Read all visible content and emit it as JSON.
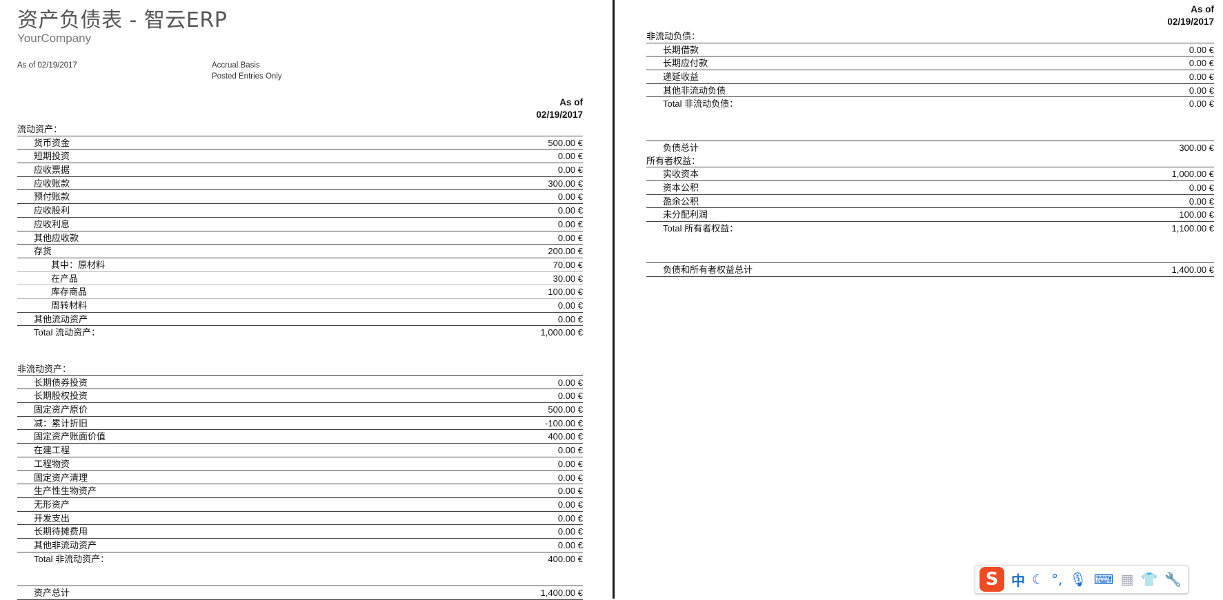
{
  "report": {
    "title": "资产负债表 - 智云ERP",
    "company": "YourCompany",
    "as_of_line": "As of 02/19/2017",
    "basis": "Accrual Basis",
    "entries": "Posted Entries Only",
    "col_header_1": "As of",
    "col_header_2": "02/19/2017"
  },
  "left": {
    "current_assets": {
      "heading": "流动资产：",
      "rows": [
        {
          "label": "货币资金",
          "value": "500.00 €"
        },
        {
          "label": "短期投资",
          "value": "0.00 €"
        },
        {
          "label": "应收票据",
          "value": "0.00 €"
        },
        {
          "label": "应收账款",
          "value": "300.00 €"
        },
        {
          "label": "预付账款",
          "value": "0.00 €"
        },
        {
          "label": "应收股利",
          "value": "0.00 €"
        },
        {
          "label": "应收利息",
          "value": "0.00 €"
        },
        {
          "label": "其他应收款",
          "value": "0.00 €"
        },
        {
          "label": "存货",
          "value": "200.00 €"
        }
      ],
      "inventory_rows": [
        {
          "label": "其中：原材料",
          "value": "70.00 €"
        },
        {
          "label": "在产品",
          "value": "30.00 €"
        },
        {
          "label": "库存商品",
          "value": "100.00 €"
        },
        {
          "label": "周转材料",
          "value": "0.00 €"
        }
      ],
      "other_row": {
        "label": "其他流动资产",
        "value": "0.00 €"
      },
      "total": {
        "label": "Total 流动资产：",
        "value": "1,000.00 €"
      }
    },
    "noncurrent_assets": {
      "heading": "非流动资产：",
      "rows": [
        {
          "label": "长期债券投资",
          "value": "0.00 €"
        },
        {
          "label": "长期股权投资",
          "value": "0.00 €"
        },
        {
          "label": "固定资产原价",
          "value": "500.00 €"
        },
        {
          "label": "减：累计折旧",
          "value": "-100.00 €"
        },
        {
          "label": "固定资产账面价值",
          "value": "400.00 €"
        },
        {
          "label": "在建工程",
          "value": "0.00 €"
        },
        {
          "label": "工程物资",
          "value": "0.00 €"
        },
        {
          "label": "固定资产清理",
          "value": "0.00 €"
        },
        {
          "label": "生产性生物资产",
          "value": "0.00 €"
        },
        {
          "label": "无形资产",
          "value": "0.00 €"
        },
        {
          "label": "开发支出",
          "value": "0.00 €"
        },
        {
          "label": "长期待摊费用",
          "value": "0.00 €"
        },
        {
          "label": "其他非流动资产",
          "value": "0.00 €"
        }
      ],
      "total": {
        "label": "Total 非流动资产：",
        "value": "400.00 €"
      }
    },
    "total_assets": {
      "label": "资产总计",
      "value": "1,400.00 €"
    }
  },
  "right": {
    "noncurrent_liabilities": {
      "heading": "非流动负债：",
      "rows": [
        {
          "label": "长期借款",
          "value": "0.00 €"
        },
        {
          "label": "长期应付款",
          "value": "0.00 €"
        },
        {
          "label": "递延收益",
          "value": "0.00 €"
        },
        {
          "label": "其他非流动负债",
          "value": "0.00 €"
        }
      ],
      "total": {
        "label": "Total 非流动负债：",
        "value": "0.00 €"
      }
    },
    "total_liabilities": {
      "label": "负债总计",
      "value": "300.00 €"
    },
    "equity": {
      "heading": "所有者权益：",
      "rows": [
        {
          "label": "实收资本",
          "value": "1,000.00 €"
        },
        {
          "label": "资本公积",
          "value": "0.00 €"
        },
        {
          "label": "盈余公积",
          "value": "0.00 €"
        },
        {
          "label": "未分配利润",
          "value": "100.00 €"
        }
      ],
      "total": {
        "label": "Total 所有者权益：",
        "value": "1,100.00 €"
      }
    },
    "total_liab_equity": {
      "label": "负债和所有者权益总计",
      "value": "1,400.00 €"
    }
  },
  "ime_toolbar": {
    "logo": "S",
    "mode": "中",
    "icons": [
      "moon-icon",
      "punctuation-icon",
      "microphone-icon",
      "keyboard-icon",
      "toolbox-icon",
      "skin-icon",
      "settings-icon"
    ]
  }
}
